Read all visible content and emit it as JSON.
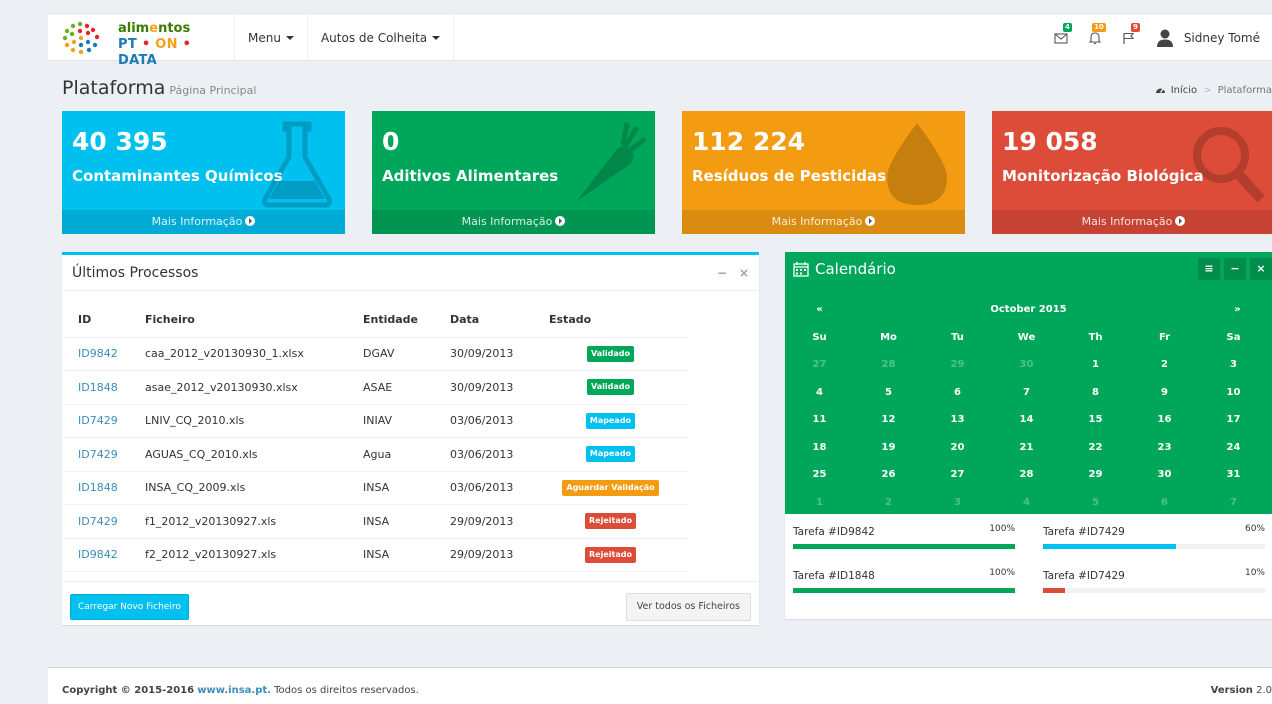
{
  "header": {
    "logo_top_a": "alim",
    "logo_top_b": "e",
    "logo_top_c": "ntos",
    "logo_bot_a": "PT",
    "logo_bot_b": "ON",
    "logo_bot_c": "DATA",
    "logo_bot_sep": "•",
    "menu_label": "Menu",
    "autos_label": "Autos de Colheita",
    "notif_counts": {
      "mail": "4",
      "bell": "10",
      "flag": "9"
    },
    "user_name": "Sidney Tomé"
  },
  "page": {
    "title": "Plataforma",
    "subtitle": "Página Principal",
    "breadcrumb": [
      "Início",
      "Plataforma"
    ]
  },
  "boxes": [
    {
      "value": "40 395",
      "label": "Contaminantes Químicos",
      "footer": "Mais Informação",
      "color": "#00c0ef"
    },
    {
      "value": "0",
      "label": "Aditivos Alimentares",
      "footer": "Mais Informação",
      "color": "#00a65a"
    },
    {
      "value": "112 224",
      "label": "Resíduos de Pesticidas",
      "footer": "Mais Informação",
      "color": "#f39c12"
    },
    {
      "value": "19 058",
      "label": "Monitorização Biológica",
      "footer": "Mais Informação",
      "color": "#dd4b39"
    }
  ],
  "processes": {
    "title": "Últimos Processos",
    "columns": [
      "ID",
      "Ficheiro",
      "Entidade",
      "Data",
      "Estado"
    ],
    "rows": [
      {
        "id": "ID9842",
        "file": "caa_2012_v20130930_1.xlsx",
        "entity": "DGAV",
        "date": "30/09/2013",
        "status": "Validado",
        "status_color": "#00a65a"
      },
      {
        "id": "ID1848",
        "file": "asae_2012_v20130930.xlsx",
        "entity": "ASAE",
        "date": "30/09/2013",
        "status": "Validado",
        "status_color": "#00a65a"
      },
      {
        "id": "ID7429",
        "file": "LNIV_CQ_2010.xls",
        "entity": "INIAV",
        "date": "03/06/2013",
        "status": "Mapeado",
        "status_color": "#00c0ef"
      },
      {
        "id": "ID7429",
        "file": "AGUAS_CQ_2010.xls",
        "entity": "Agua",
        "date": "03/06/2013",
        "status": "Mapeado",
        "status_color": "#00c0ef"
      },
      {
        "id": "ID1848",
        "file": "INSA_CQ_2009.xls",
        "entity": "INSA",
        "date": "03/06/2013",
        "status": "Aguardar Validação",
        "status_color": "#f39c12"
      },
      {
        "id": "ID7429",
        "file": "f1_2012_v20130927.xls",
        "entity": "INSA",
        "date": "29/09/2013",
        "status": "Rejeitado",
        "status_color": "#dd4b39"
      },
      {
        "id": "ID9842",
        "file": "f2_2012_v20130927.xls",
        "entity": "INSA",
        "date": "29/09/2013",
        "status": "Rejeitado",
        "status_color": "#dd4b39"
      }
    ],
    "upload_button": "Carregar Novo Ficheiro",
    "view_all_button": "Ver todos os Ficheiros"
  },
  "calendar": {
    "title": "Calendário",
    "prev": "«",
    "month": "October 2015",
    "next": "»",
    "weekdays": [
      "Su",
      "Mo",
      "Tu",
      "We",
      "Th",
      "Fr",
      "Sa"
    ],
    "weeks": [
      [
        "27",
        "28",
        "29",
        "30",
        "1",
        "2",
        "3"
      ],
      [
        "4",
        "5",
        "6",
        "7",
        "8",
        "9",
        "10"
      ],
      [
        "11",
        "12",
        "13",
        "14",
        "15",
        "16",
        "17"
      ],
      [
        "18",
        "19",
        "20",
        "21",
        "22",
        "23",
        "24"
      ],
      [
        "25",
        "26",
        "27",
        "28",
        "29",
        "30",
        "31"
      ],
      [
        "1",
        "2",
        "3",
        "4",
        "5",
        "6",
        "7"
      ]
    ],
    "muted_prefix": 4,
    "muted_last_week": true
  },
  "tasks": [
    {
      "name": "Tarefa #ID9842",
      "percent": "100%",
      "value": 100,
      "color": "#00a65a"
    },
    {
      "name": "Tarefa #ID7429",
      "percent": "60%",
      "value": 60,
      "color": "#00c0ef"
    },
    {
      "name": "Tarefa #ID1848",
      "percent": "100%",
      "value": 100,
      "color": "#00a65a"
    },
    {
      "name": "Tarefa #ID7429",
      "percent": "10%",
      "value": 10,
      "color": "#dd4b39"
    }
  ],
  "footer": {
    "copyright": "Copyright © 2015-2016",
    "site": "www.insa.pt.",
    "rights": "Todos os direitos reservados.",
    "version_label": "Version",
    "version": "2.0"
  }
}
